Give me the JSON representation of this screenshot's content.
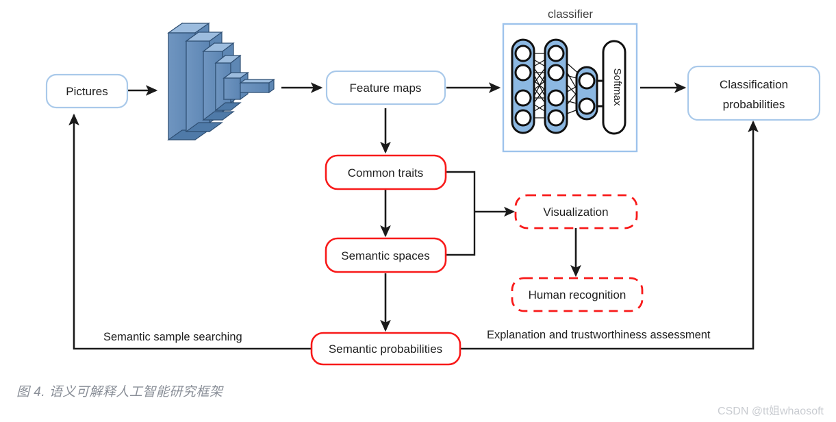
{
  "figure": {
    "caption": "图 4. 语义可解释人工智能研究框架",
    "watermark": "CSDN @tt姐whaosoft"
  },
  "colors": {
    "blue_border": "#a9c9ea",
    "red_border": "#f81a1a",
    "cnn_slab": "#6f95c0",
    "nn_layer_fill": "#8cb8e2",
    "edge": "#1a1a1a",
    "caption_text": "#8a8f98",
    "watermark_text": "#c9ccd1"
  },
  "nodes": {
    "pictures": {
      "label": "Pictures",
      "style": "blue-solid"
    },
    "feature_maps": {
      "label": "Feature maps",
      "style": "blue-solid"
    },
    "classification_probabilities": {
      "label_line1": "Classification",
      "label_line2": "probabilities",
      "style": "blue-solid"
    },
    "common_traits": {
      "label": "Common traits",
      "style": "red-solid"
    },
    "semantic_spaces": {
      "label": "Semantic spaces",
      "style": "red-solid"
    },
    "semantic_probabilities": {
      "label": "Semantic probabilities",
      "style": "red-solid"
    },
    "visualization": {
      "label": "Visualization",
      "style": "red-dashed"
    },
    "human_recognition": {
      "label": "Human recognition",
      "style": "red-dashed"
    }
  },
  "classifier": {
    "title": "classifier",
    "softmax_label": "Softmax",
    "layer_node_counts": [
      4,
      4,
      2
    ]
  },
  "edge_labels": {
    "semantic_sample_searching": "Semantic sample searching",
    "explanation_assessment": "Explanation and trustworthiness assessment"
  }
}
